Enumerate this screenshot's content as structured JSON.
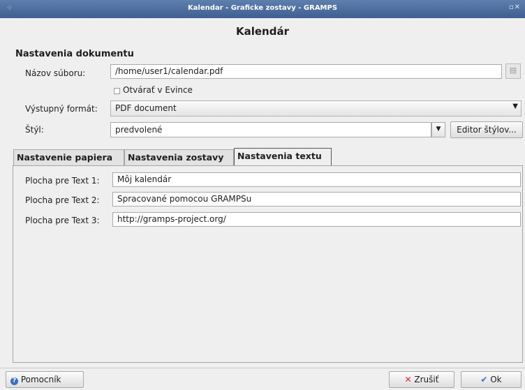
{
  "window": {
    "title": "Kalendar - Graficke zostavy - GRAMPS"
  },
  "heading": "Kalendár",
  "document_settings": {
    "section_title": "Nastavenia dokumentu",
    "filename_label": "Názov súboru:",
    "filename_value": "/home/user1/calendar.pdf",
    "open_in_viewer_label": "Otvárať v Evince",
    "open_in_viewer_checked": false,
    "output_format_label": "Výstupný formát:",
    "output_format_value": "PDF document",
    "style_label": "Štýl:",
    "style_value": "predvolené",
    "style_editor_button": "Editor štýlov..."
  },
  "tabs": [
    {
      "label": "Nastavenie papiera",
      "active": false
    },
    {
      "label": "Nastavenia zostavy",
      "active": false
    },
    {
      "label": "Nastavenia textu",
      "active": true
    }
  ],
  "text_settings": [
    {
      "label": "Plocha pre Text 1:",
      "value": "Môj kalendár"
    },
    {
      "label": "Plocha pre Text 2:",
      "value": "Spracované pomocou GRAMPSu"
    },
    {
      "label": "Plocha pre Text 3:",
      "value": "http://gramps-project.org/"
    }
  ],
  "buttons": {
    "help": "Pomocník",
    "cancel": "Zrušiť",
    "ok": "Ok"
  },
  "colors": {
    "titlebar": "#4a6a9c",
    "cancel_icon": "#d42a2a",
    "ok_icon": "#3a6fc4"
  }
}
